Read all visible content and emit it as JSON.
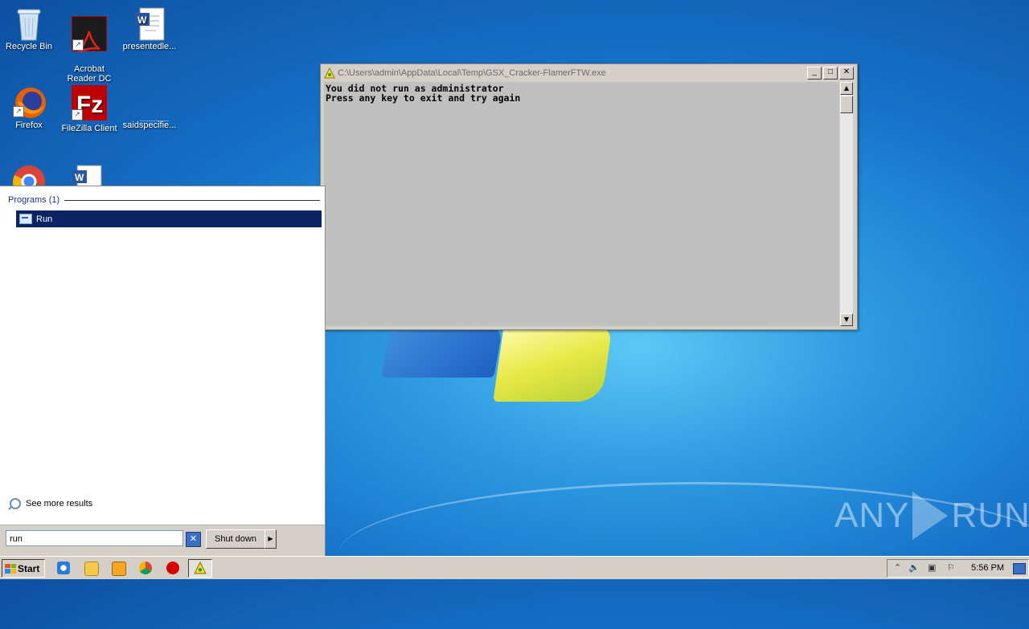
{
  "desktop": {
    "icons": [
      {
        "label": "Recycle Bin",
        "icon": "recycle-bin-icon"
      },
      {
        "label": "Acrobat\nReader DC",
        "icon": "acrobat-icon"
      },
      {
        "label": "presentedle...",
        "icon": "word-doc-icon"
      },
      {
        "label": "Firefox",
        "icon": "firefox-icon"
      },
      {
        "label": "FileZilla Client",
        "icon": "filezilla-icon"
      },
      {
        "label": "saidspecifie...",
        "icon": "blank-file-icon"
      }
    ]
  },
  "console": {
    "title": "C:\\Users\\admin\\AppData\\Local\\Temp\\GSX_Cracker-FlamerFTW.exe",
    "lines": [
      "You did not run as administrator",
      "Press any key to exit and try again"
    ]
  },
  "start_menu": {
    "section_header": "Programs (1)",
    "result": "Run",
    "see_more": "See more results",
    "search_value": "run",
    "shutdown_label": "Shut down"
  },
  "taskbar": {
    "start_label": "Start",
    "clock": "5:56 PM"
  },
  "watermark": {
    "left": "ANY",
    "right": "RUN"
  }
}
